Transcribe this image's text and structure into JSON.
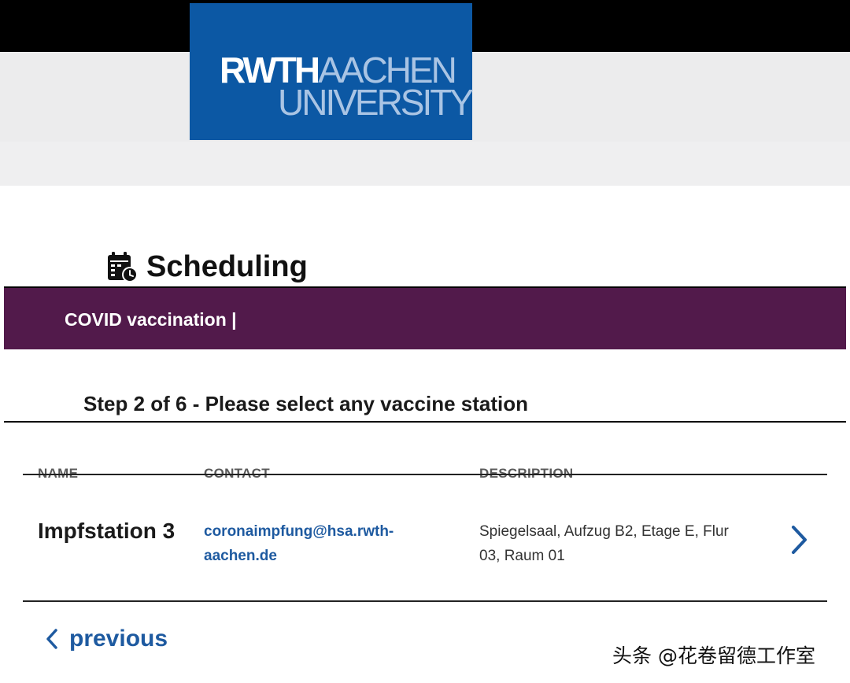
{
  "header": {
    "logo": {
      "line1_strong": "RWTH",
      "line1_light": "AACHEN",
      "line2": "UNIVERSITY"
    }
  },
  "page": {
    "title": "Scheduling",
    "title_icon": "calendar-clock-icon"
  },
  "banner": {
    "text": "COVID vaccination |"
  },
  "step": {
    "title": "Step 2 of 6 - Please select any vaccine station"
  },
  "table": {
    "columns": [
      "NAME",
      "CONTACT",
      "DESCRIPTION"
    ],
    "rows": [
      {
        "name": "Impfstation 3",
        "contact": "coronaimpfung@hsa.rwth-aachen.de",
        "description": "Spiegelsaal, Aufzug B2, Etage E, Flur 03, Raum 01",
        "action_icon": "chevron-right-icon"
      }
    ]
  },
  "navigation": {
    "previous_label": "previous",
    "previous_icon": "chevron-left-icon"
  },
  "watermark": {
    "text": "头条 @花卷留德工作室"
  },
  "colors": {
    "logo_blue": "#0c58a4",
    "banner_purple": "#521a4b",
    "link_blue": "#1e5aa0"
  }
}
